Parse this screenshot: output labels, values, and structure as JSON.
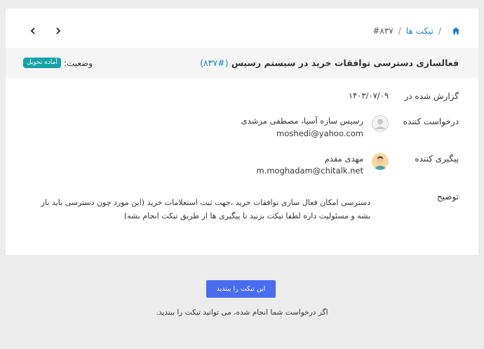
{
  "breadcrumb": {
    "home_icon": "home-icon",
    "separator": "/",
    "tickets_label": "تیکت ها",
    "current": "#۸۳۷"
  },
  "nav": {
    "next_icon": "chevron-right-icon",
    "prev_icon": "chevron-left-icon"
  },
  "ticket": {
    "title": "فعالسازی دسترسی توافقات خرید در سیستم رسیس",
    "number": "(#۸۳۷)",
    "status_label": "وضعیت:",
    "status_badge": "آماده تحویل",
    "status_color": "#17a2a8"
  },
  "details": {
    "reported_label": "گزارش شده در",
    "reported_value": "۱۴۰۳/۰۷/۰۹",
    "requester_label": "درخواست کننده",
    "requester_name": "رسیس سازه آسیا، مصطفی مرشدی",
    "requester_email": "moshedi@yahoo.com",
    "follower_label": "پیگیری کننده",
    "follower_name": "مهدی مقدم",
    "follower_email": "m.moghadam@chitalk.net",
    "description_label": "توضیح",
    "description_text": "دسترسی امکان فعال سازی توافقات خرید ،جهت ثبت استعلامات خرید (این مورد چون دسترسی باید باز بشه و مسئولیت داره لطفا تیکت بزنید تا پیگیری ها از طریق تیکت انجام بشه)"
  },
  "footer": {
    "close_button": "این تیکت را ببندید",
    "note": "اگر درخواست شما انجام شده، می توانید تیکت را ببندید."
  },
  "colors": {
    "accent": "#4a6cf0",
    "link": "#1a7fd0"
  }
}
